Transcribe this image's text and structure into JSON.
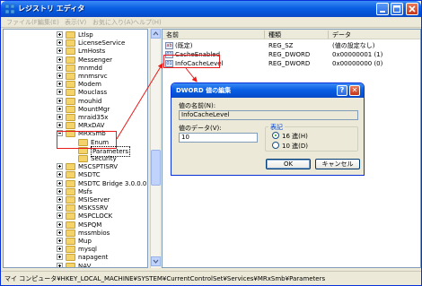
{
  "window": {
    "title": "レジストリ エディタ",
    "menu": [
      "ファイル(F)",
      "編集(E)",
      "表示(V)",
      "お気に入り(A)",
      "ヘルプ(H)"
    ]
  },
  "tree": {
    "items": [
      {
        "label": "Ltlsp",
        "expander": "plus"
      },
      {
        "label": "LicenseService",
        "expander": "plus"
      },
      {
        "label": "LmHosts",
        "expander": "plus"
      },
      {
        "label": "Messenger",
        "expander": "plus"
      },
      {
        "label": "mnmdd",
        "expander": "plus"
      },
      {
        "label": "mnmsrvc",
        "expander": "plus"
      },
      {
        "label": "Modem",
        "expander": "plus"
      },
      {
        "label": "Mouclass",
        "expander": "plus"
      },
      {
        "label": "mouhid",
        "expander": "plus"
      },
      {
        "label": "MountMgr",
        "expander": "plus"
      },
      {
        "label": "mraid35x",
        "expander": "plus"
      },
      {
        "label": "MRxDAV",
        "expander": "plus"
      },
      {
        "label": "MRxSmb",
        "expander": "minus"
      },
      {
        "label": "Enum",
        "expander": "none",
        "child": true
      },
      {
        "label": "Parameters",
        "expander": "none",
        "child": true,
        "selected": true
      },
      {
        "label": "Security",
        "expander": "none",
        "child": true
      },
      {
        "label": "MSCSPTISRV",
        "expander": "plus"
      },
      {
        "label": "MSDTC",
        "expander": "plus"
      },
      {
        "label": "MSDTC Bridge 3.0.0.0",
        "expander": "plus"
      },
      {
        "label": "Msfs",
        "expander": "plus"
      },
      {
        "label": "MSIServer",
        "expander": "plus"
      },
      {
        "label": "MSKSSRV",
        "expander": "plus"
      },
      {
        "label": "MSPCLOCK",
        "expander": "plus"
      },
      {
        "label": "MSPQM",
        "expander": "plus"
      },
      {
        "label": "mssmbios",
        "expander": "plus"
      },
      {
        "label": "Mup",
        "expander": "plus"
      },
      {
        "label": "mysql",
        "expander": "plus"
      },
      {
        "label": "napagent",
        "expander": "plus"
      },
      {
        "label": "NAV",
        "expander": "plus"
      }
    ]
  },
  "list": {
    "columns": [
      "名前",
      "種類",
      "データ"
    ],
    "rows": [
      {
        "icon": "ab",
        "name": "(既定)",
        "type": "REG_SZ",
        "data": "(値の設定なし)"
      },
      {
        "icon": "01",
        "name": "CacheEnabled",
        "type": "REG_DWORD",
        "data": "0x00000001 (1)"
      },
      {
        "icon": "01",
        "name": "InfoCacheLevel",
        "type": "REG_DWORD",
        "data": "0x00000000 (0)"
      }
    ]
  },
  "status": "マイ コンピュータ¥HKEY_LOCAL_MACHINE¥SYSTEM¥CurrentControlSet¥Services¥MRxSmb¥Parameters",
  "dialog": {
    "title": "DWORD 値の編集",
    "name_label": "値の名前(N):",
    "name_value": "InfoCacheLevel",
    "data_label": "値のデータ(V):",
    "data_value": "10",
    "base_label": "表記",
    "hex_label": "16 進(H)",
    "dec_label": "10 進(D)",
    "base_selected": "16 進(H)",
    "ok": "OK",
    "cancel": "キャンセル",
    "help_glyph": "?",
    "close_glyph": "✕"
  },
  "colors": {
    "titlebar": "#0a5fe3",
    "annotation": "#e81a1a",
    "folder": "#f4d36b"
  }
}
